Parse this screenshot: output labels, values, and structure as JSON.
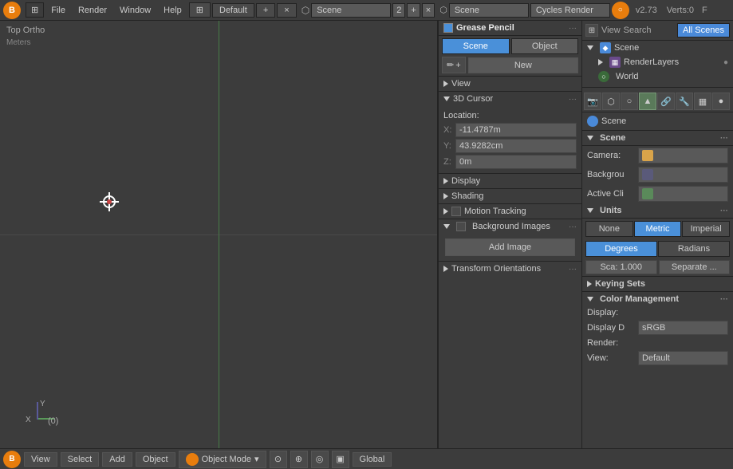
{
  "topbar": {
    "logo": "B",
    "menus": [
      "File",
      "Render",
      "Window",
      "Help"
    ],
    "editor_type": "🔲",
    "workspace": "Default",
    "workspace_add": "+",
    "workspace_close": "×",
    "scene_icon": "⬡",
    "scene_name": "Scene",
    "scene_num": "2",
    "render_engine": "Cycles Render",
    "version": "v2.73",
    "verts": "Verts:0",
    "panel_right": "F"
  },
  "viewport": {
    "view_label": "Top Ortho",
    "units_label": "Meters",
    "frame_num": "(0)"
  },
  "gp_panel": {
    "title": "Grease Pencil",
    "checkbox": true,
    "dots": "···",
    "tab_scene": "Scene",
    "tab_object": "Object",
    "pencil_icon": "✏",
    "plus_icon": "+",
    "new_label": "New",
    "view_section": "View",
    "cursor_section": "3D Cursor",
    "cursor_location_label": "Location:",
    "cursor_x_label": "X:",
    "cursor_x_value": "-11.4787m",
    "cursor_y_label": "Y:",
    "cursor_y_value": "43.9282cm",
    "cursor_z_label": "Z:",
    "cursor_z_value": "0m",
    "display_section": "Display",
    "shading_section": "Shading",
    "motion_tracking_label": "Motion Tracking",
    "bg_images_label": "Background Images",
    "bg_images_dots": "···",
    "add_image_btn": "Add Image",
    "transform_section": "Transform Orientations",
    "transform_dots": "···"
  },
  "outliner": {
    "header_icon": "🌐",
    "header_label": "Scene",
    "all_scenes_btn": "All Scenes",
    "view_btn": "View",
    "search_btn": "Search",
    "items": [
      {
        "label": "Scene",
        "icon": "scene",
        "indent": 0
      },
      {
        "label": "RenderLayers",
        "icon": "renderlayer",
        "indent": 1,
        "has_dot": true
      },
      {
        "label": "World",
        "icon": "world",
        "indent": 1
      }
    ]
  },
  "props_icons": [
    "⚙",
    "🎬",
    "👁",
    "🔧",
    "⚡",
    "🎯",
    "📷"
  ],
  "props_panel": {
    "scene_label": "Scene",
    "scene_section_label": "Scene",
    "scene_dots": "···",
    "camera_label": "Camera:",
    "camera_value": "",
    "background_label": "Backgrou",
    "background_value": "",
    "active_label": "Active Cli",
    "active_value": "",
    "units_label": "Units",
    "units_dots": "···",
    "units_none": "None",
    "units_metric": "Metric",
    "units_imperial": "Imperial",
    "units_degrees": "Degrees",
    "units_radians": "Radians",
    "scale_label": "Sca: 1.000",
    "separate_label": "Separate ...",
    "keying_label": "Keying Sets",
    "keying_triangle": "▶",
    "color_mgmt_label": "Color Management",
    "color_mgmt_dots": "···",
    "display_label": "Display:",
    "display_d_label": "Display D",
    "display_d_value": "sRGB",
    "render_label": "Render:",
    "view_label": "View:",
    "view_value": "Default"
  },
  "bottombar": {
    "logo": "B",
    "view_btn": "View",
    "select_btn": "Select",
    "add_btn": "Add",
    "object_btn": "Object",
    "mode_label": "Object Mode",
    "global_label": "Global"
  }
}
